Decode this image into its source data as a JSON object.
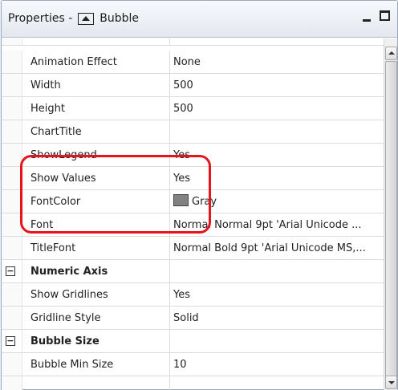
{
  "window": {
    "title_prefix": "Properties - ",
    "title_object": "Bubble",
    "title_icon": "chart-object-icon",
    "minimize_icon": "minimize-icon",
    "maximize_icon": "maximize-icon"
  },
  "properties": [
    {
      "name": "Animation Effect",
      "value": "None"
    },
    {
      "name": "Width",
      "value": "500"
    },
    {
      "name": "Height",
      "value": "500"
    },
    {
      "name": "ChartTitle",
      "value": ""
    },
    {
      "name": "ShowLegend",
      "value": "Yes"
    },
    {
      "name": "Show Values",
      "value": "Yes"
    },
    {
      "name": "FontColor",
      "value": "Gray",
      "swatch": "#828282"
    },
    {
      "name": "Font",
      "value": "Normal Normal 9pt 'Arial Unicode ..."
    },
    {
      "name": "TitleFont",
      "value": "Normal Bold 9pt 'Arial Unicode MS,..."
    }
  ],
  "sections": {
    "numeric_axis": {
      "label": "Numeric Axis",
      "toggle": "⊟",
      "items": [
        {
          "name": "Show Gridlines",
          "value": "Yes"
        },
        {
          "name": "Gridline Style",
          "value": "Solid"
        }
      ]
    },
    "bubble_size": {
      "label": "Bubble Size",
      "toggle": "⊟",
      "items": [
        {
          "name": "Bubble Min Size",
          "value": "10"
        }
      ]
    }
  },
  "colors": {
    "highlight": "#e8141c",
    "font_color_swatch": "#828282"
  }
}
